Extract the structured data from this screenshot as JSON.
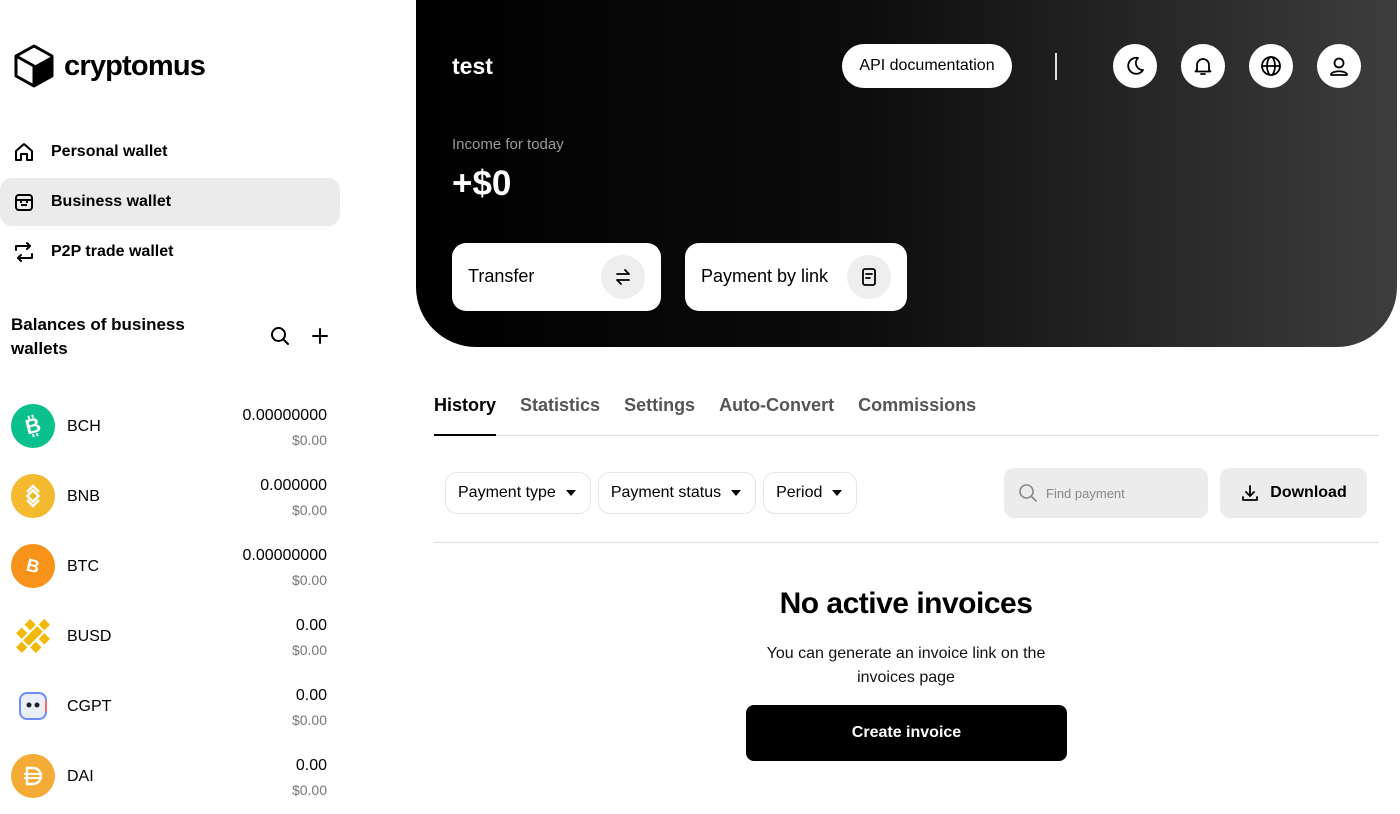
{
  "brand": {
    "name": "cryptomus"
  },
  "nav": {
    "items": [
      {
        "label": "Personal wallet",
        "icon": "home-icon"
      },
      {
        "label": "Business wallet",
        "icon": "store-icon",
        "active": true
      },
      {
        "label": "P2P trade wallet",
        "icon": "exchange-icon"
      }
    ]
  },
  "balances": {
    "title": "Balances of business wallets",
    "coins": [
      {
        "ticker": "BCH",
        "amount": "0.00000000",
        "usd": "$0.00",
        "color": "#0AC18E",
        "icon": "bitcoin-cash-icon"
      },
      {
        "ticker": "BNB",
        "amount": "0.000000",
        "usd": "$0.00",
        "color": "#F3BA2F",
        "icon": "bnb-icon"
      },
      {
        "ticker": "BTC",
        "amount": "0.00000000",
        "usd": "$0.00",
        "color": "#F7931A",
        "icon": "bitcoin-icon"
      },
      {
        "ticker": "BUSD",
        "amount": "0.00",
        "usd": "$0.00",
        "color": "#F0B90B",
        "icon": "busd-icon"
      },
      {
        "ticker": "CGPT",
        "amount": "0.00",
        "usd": "$0.00",
        "color": "#6c8cff",
        "icon": "cgpt-icon"
      },
      {
        "ticker": "DAI",
        "amount": "0.00",
        "usd": "$0.00",
        "color": "#F5AC37",
        "icon": "dai-icon"
      }
    ]
  },
  "header": {
    "title": "test",
    "api_button": "API documentation",
    "income_label": "Income for today",
    "income_value": "+$0",
    "transfer_label": "Transfer",
    "payment_link_label": "Payment by link"
  },
  "tabs": [
    "History",
    "Statistics",
    "Settings",
    "Auto-Convert",
    "Commissions"
  ],
  "filters": {
    "payment_type": "Payment type",
    "payment_status": "Payment status",
    "period": "Period",
    "search_placeholder": "Find payment",
    "download": "Download"
  },
  "empty_state": {
    "title": "No active invoices",
    "subtitle": "You can generate an invoice link on the invoices page",
    "button": "Create invoice"
  }
}
